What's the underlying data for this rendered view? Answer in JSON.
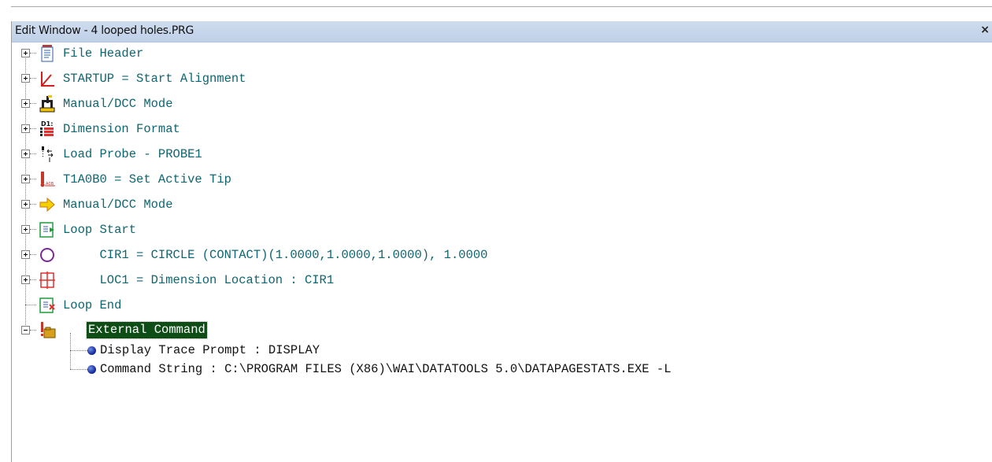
{
  "window": {
    "title": "Edit Window - 4 looped holes.PRG",
    "close_glyph": "×"
  },
  "tree": {
    "items": [
      {
        "label": "File Header",
        "icon": "file-header-icon",
        "state": "collapsed"
      },
      {
        "label": "STARTUP = Start Alignment",
        "icon": "alignment-icon",
        "state": "collapsed"
      },
      {
        "label": "Manual/DCC Mode",
        "icon": "cmm-machine-icon",
        "state": "collapsed"
      },
      {
        "label": "Dimension Format",
        "icon": "dimension-format-icon",
        "state": "collapsed"
      },
      {
        "label": "Load Probe - PROBE1",
        "icon": "load-probe-icon",
        "state": "collapsed"
      },
      {
        "label": "T1A0B0 = Set Active Tip",
        "icon": "probe-tip-icon",
        "state": "collapsed"
      },
      {
        "label": "Manual/DCC Mode",
        "icon": "yellow-arrow-icon",
        "state": "collapsed"
      },
      {
        "label": "Loop Start",
        "icon": "loop-start-icon",
        "state": "collapsed"
      },
      {
        "label": "     CIR1 = CIRCLE (CONTACT)(1.0000,1.0000,1.0000), 1.0000",
        "icon": "circle-feature-icon",
        "state": "collapsed"
      },
      {
        "label": "     LOC1 = Dimension Location : CIR1",
        "icon": "location-dimension-icon",
        "state": "collapsed"
      },
      {
        "label": "Loop End",
        "icon": "loop-end-icon",
        "state": "leaf"
      },
      {
        "label": "External Command",
        "icon": "external-command-icon",
        "state": "expanded",
        "selected": true
      }
    ],
    "children": [
      {
        "label": "Display Trace Prompt : DISPLAY",
        "icon": "blue-bullet-icon"
      },
      {
        "label": "Command String : C:\\PROGRAM FILES (X86)\\WAI\\DATATOOLS 5.0\\DATAPAGESTATS.EXE -L",
        "icon": "blue-bullet-icon"
      }
    ]
  },
  "colors": {
    "label_text": "#0e6670",
    "selection_bg": "#0f4d17",
    "titlebar": "#c8d7ec"
  }
}
